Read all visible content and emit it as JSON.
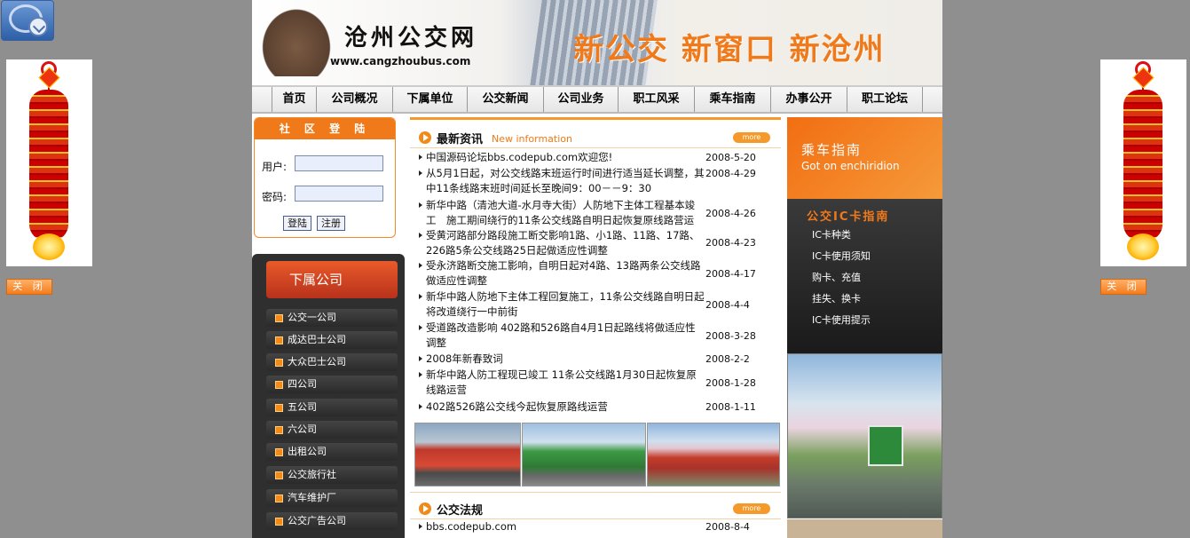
{
  "brand": {
    "site_name": "沧州公交网",
    "url": "www.cangzhoubus.com",
    "slogan": "新公交 新窗口 新沧州"
  },
  "nav": [
    "首页",
    "公司概况",
    "下属单位",
    "公交新闻",
    "公司业务",
    "职工风采",
    "乘车指南",
    "办事公开",
    "职工论坛"
  ],
  "side_widgets": {
    "close_label": "关 闭"
  },
  "login": {
    "title": "社 区 登 陆",
    "user_label": "用户:",
    "pass_label": "密码:",
    "login_button": "登陆",
    "register_button": "注册"
  },
  "subsidiaries": {
    "title": "下属公司",
    "items": [
      "公交一公司",
      "成达巴士公司",
      "大众巴士公司",
      "四公司",
      "五公司",
      "六公司",
      "出租公司",
      "公交旅行社",
      "汽车维护厂",
      "公交广告公司"
    ]
  },
  "news": {
    "title": "最新资讯",
    "subtitle": "New information",
    "more": "more",
    "items": [
      {
        "title": "中国源码论坛bbs.codepub.com欢迎您!",
        "date": "2008-5-20"
      },
      {
        "title": "从5月1日起，对公交线路末班运行时间进行适当延长调整，其中11条线路末班时间延长至晚间9：00－－9：30",
        "date": "2008-4-29"
      },
      {
        "title": "新华中路（清池大道-水月寺大街）人防地下主体工程基本竣工　施工期间绕行的11条公交线路自明日起恢复原线路营运",
        "date": "2008-4-26"
      },
      {
        "title": "受黄河路部分路段施工断交影响1路、小1路、11路、17路、226路5条公交线路25日起做适应性调整",
        "date": "2008-4-23"
      },
      {
        "title": "受永济路断交施工影响，自明日起对4路、13路两条公交线路做适应性调整",
        "date": "2008-4-17"
      },
      {
        "title": "新华中路人防地下主体工程回复施工，11条公交线路自明日起将改道绕行一中前街",
        "date": "2008-4-4"
      },
      {
        "title": "受道路改造影响 402路和526路自4月1日起路线将做适应性调整",
        "date": "2008-3-28"
      },
      {
        "title": "2008年新春致词",
        "date": "2008-2-2"
      },
      {
        "title": "新华中路人防工程现已竣工 11条公交线路1月30日起恢复原线路运营",
        "date": "2008-1-28"
      },
      {
        "title": "402路526路公交线今起恢复原路线运营",
        "date": "2008-1-11"
      }
    ]
  },
  "law": {
    "title": "公交法规",
    "more": "more",
    "items": [
      {
        "title": "bbs.codepub.com",
        "date": "2008-8-4"
      }
    ]
  },
  "guide": {
    "title": "乘车指南",
    "subtitle": "Got on enchiridion"
  },
  "ic_card": {
    "title": "公交IC卡指南",
    "items": [
      "IC卡种类",
      "IC卡使用须知",
      "购卡、充值",
      "挂失、换卡",
      "IC卡使用提示"
    ]
  },
  "colors": {
    "accent": "#f07a1a",
    "page_bg": "#8f8f8f",
    "dark_panel": "#2f2f2f"
  }
}
